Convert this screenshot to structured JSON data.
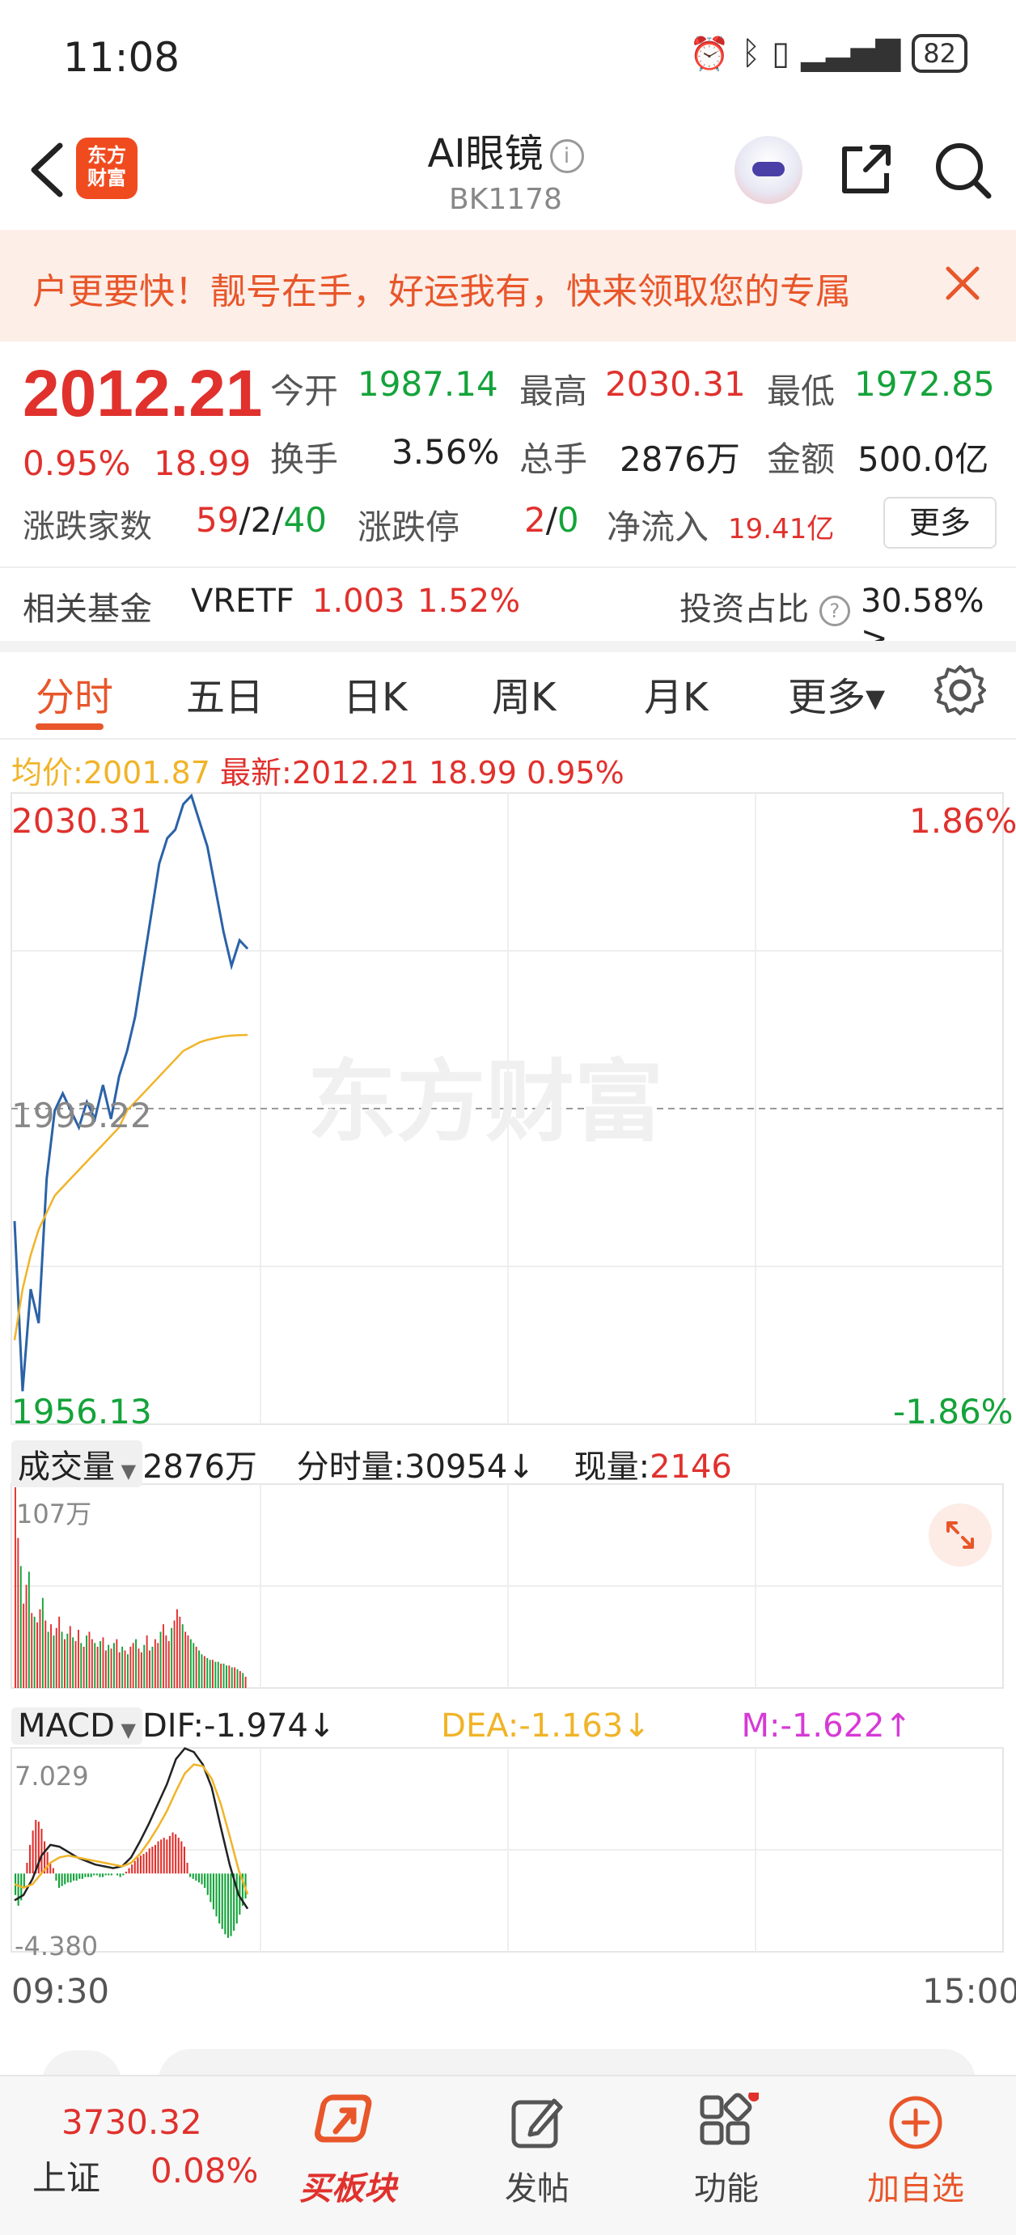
{
  "status_bar": {
    "time": "11:08",
    "battery": "82"
  },
  "header": {
    "title": "AI眼镜",
    "code": "BK1178",
    "logo_text_line1": "东方",
    "logo_text_line2": "财富"
  },
  "banner": {
    "text": "户更要快！靓号在手，好运我有，快来领取您的专属"
  },
  "quote": {
    "price": "2012.21",
    "change_pct": "0.95%",
    "change": "18.99",
    "open_label": "今开",
    "open": "1987.14",
    "high_label": "最高",
    "high": "2030.31",
    "low_label": "最低",
    "low": "1972.85",
    "turnover_label": "换手",
    "turnover": "3.56%",
    "volume_label": "总手",
    "volume": "2876万",
    "amount_label": "金额",
    "amount": "500.0亿",
    "breadth_label": "涨跌家数",
    "breadth_up": "59",
    "breadth_flat": "2",
    "breadth_down": "40",
    "limit_label": "涨跌停",
    "limit_up": "2",
    "limit_down": "0",
    "inflow_label": "净流入",
    "inflow": "19.41亿",
    "more": "更多"
  },
  "fund": {
    "label": "相关基金",
    "name": "VRETF",
    "price": "1.003",
    "pct": "1.52%",
    "invest_label": "投资占比",
    "invest_value": "30.58% >"
  },
  "tabs": [
    "分时",
    "五日",
    "日K",
    "周K",
    "月K",
    "更多▾"
  ],
  "chart_info": {
    "avg_label": "均价:",
    "avg": "2001.87",
    "latest_label": "最新:",
    "latest": "2012.21",
    "latest_chg": "18.99",
    "latest_pct": "0.95%"
  },
  "price_chart": {
    "y_high": "2030.31",
    "y_low": "1956.13",
    "y_mid": "1993.22",
    "pct_high": "1.86%",
    "pct_low": "-1.86%",
    "watermark": "东方财富"
  },
  "volume_panel": {
    "selector": "成交量",
    "total": "2876万",
    "period_label": "分时量:",
    "period_value": "30954↓",
    "now_label": "现量:",
    "now_value": "2146",
    "y_max": "107万"
  },
  "macd_panel": {
    "selector": "MACD",
    "dif": "DIF:-1.974↓",
    "dea": "DEA:-1.163↓",
    "m": "M:-1.622↑",
    "y_max": "7.029",
    "y_min": "-4.380"
  },
  "time_axis": {
    "start": "09:30",
    "end": "15:00"
  },
  "bottom_nav": {
    "index_value": "3730.32",
    "index_name": "上证",
    "index_pct": "0.08%",
    "buy_sector": "买板块",
    "post": "发帖",
    "functions": "功能",
    "add_watch": "加自选"
  },
  "colors": {
    "up": "#e0312d",
    "down": "#14a33a",
    "accent": "#e8562a",
    "avg_line": "#f0b428",
    "price_line": "#2b62a8"
  },
  "chart_data": [
    {
      "type": "line",
      "title": "",
      "ylim": [
        1956.13,
        2030.31
      ],
      "series": [
        {
          "values": [
            1980,
            1960,
            1972,
            1968,
            1985,
            1993,
            1995,
            1993,
            1991,
            1994,
            1992,
            1996,
            1992,
            1997,
            2000,
            2004,
            2010,
            2016,
            2022,
            2025,
            2026,
            2029,
            2030,
            2027,
            2024,
            2019,
            2014,
            2010,
            2013,
            2012
          ]
        },
        {
          "values": [
            1966,
            1972,
            1976,
            1979,
            1981,
            1983,
            1984,
            1985,
            1986,
            1987,
            1988,
            1989,
            1990,
            1991,
            1993,
            1994,
            1995,
            1996,
            1997,
            1998,
            1999,
            2000,
            2000.5,
            2001,
            2001.3,
            2001.5,
            2001.7,
            2001.8,
            2001.85,
            2001.87
          ]
        }
      ]
    },
    {
      "type": "bar",
      "title": "",
      "ylim": [
        0,
        107
      ],
      "values": [
        107,
        80,
        65,
        45,
        55,
        62,
        40,
        38,
        35,
        42,
        48,
        36,
        30,
        34,
        28,
        32,
        38,
        30,
        26,
        29,
        33,
        27,
        25,
        31,
        24,
        22,
        28,
        30,
        26,
        24,
        22,
        25,
        27,
        20,
        23,
        21,
        24,
        26,
        19,
        22,
        20,
        18,
        22,
        24,
        26,
        21,
        19,
        23,
        28,
        20,
        22,
        26,
        24,
        30,
        34,
        28,
        25,
        32,
        36,
        42,
        38,
        34,
        30,
        28,
        26,
        24,
        22,
        20,
        18,
        17,
        16,
        15,
        15,
        14,
        14,
        13,
        13,
        12,
        12,
        11,
        11,
        10,
        9,
        8,
        6
      ],
      "up": [
        1,
        1,
        0,
        1,
        1,
        0,
        1,
        0,
        1,
        1,
        0,
        1,
        0,
        1,
        0,
        1,
        1,
        0,
        1,
        0,
        1,
        0,
        1,
        1,
        0,
        1,
        0,
        1,
        1,
        0,
        1,
        0,
        1,
        1,
        0,
        1,
        0,
        1,
        1,
        0,
        1,
        0,
        1,
        1,
        0,
        1,
        1,
        0,
        1,
        1,
        0,
        1,
        1,
        0,
        1,
        1,
        1,
        0,
        1,
        1,
        1,
        0,
        1,
        1,
        0,
        0,
        1,
        0,
        0,
        1,
        0,
        0,
        1,
        0,
        0,
        1,
        0,
        0,
        1,
        0,
        1,
        0,
        1,
        0,
        1
      ]
    },
    {
      "type": "bar",
      "title": "",
      "ylim": [
        -4.38,
        7.029
      ],
      "values": [
        -1.2,
        -1.8,
        -1.5,
        -0.8,
        0.6,
        1.6,
        2.4,
        3.0,
        2.9,
        2.5,
        1.8,
        1.2,
        0.6,
        0.3,
        -0.4,
        -0.8,
        -0.7,
        -0.6,
        -0.5,
        -0.5,
        -0.4,
        -0.4,
        -0.3,
        -0.3,
        -0.2,
        -0.2,
        -0.2,
        -0.1,
        -0.1,
        -0.2,
        -0.2,
        -0.1,
        -0.1,
        -0.1,
        0.0,
        -0.1,
        -0.2,
        -0.1,
        0.1,
        0.3,
        0.5,
        0.7,
        0.9,
        1.0,
        1.1,
        1.2,
        1.4,
        1.5,
        1.6,
        1.8,
        1.9,
        2.0,
        1.9,
        2.1,
        2.3,
        2.2,
        2.0,
        1.8,
        1.5,
        0.6,
        -0.2,
        -0.3,
        -0.4,
        -0.5,
        -0.6,
        -0.8,
        -1.2,
        -1.6,
        -2.0,
        -2.4,
        -2.8,
        -3.1,
        -3.4,
        -3.6,
        -3.5,
        -3.2,
        -2.8,
        -2.3,
        -1.8,
        -1.4
      ],
      "dif": [
        -1.5,
        -1.2,
        -0.3,
        1.0,
        1.6,
        1.5,
        1.2,
        0.9,
        0.7,
        0.5,
        0.4,
        0.3,
        0.4,
        0.9,
        1.8,
        2.8,
        3.9,
        5.0,
        6.4,
        7.0,
        6.8,
        6.1,
        4.8,
        2.6,
        0.5,
        -1.2,
        -1.97
      ],
      "dea": [
        -0.6,
        -0.8,
        -0.6,
        0.0,
        0.6,
        0.9,
        1.0,
        0.9,
        0.8,
        0.7,
        0.6,
        0.5,
        0.4,
        0.6,
        1.1,
        1.8,
        2.6,
        3.5,
        4.6,
        5.6,
        6.1,
        6.0,
        5.3,
        3.9,
        2.1,
        0.2,
        -1.16
      ]
    }
  ]
}
